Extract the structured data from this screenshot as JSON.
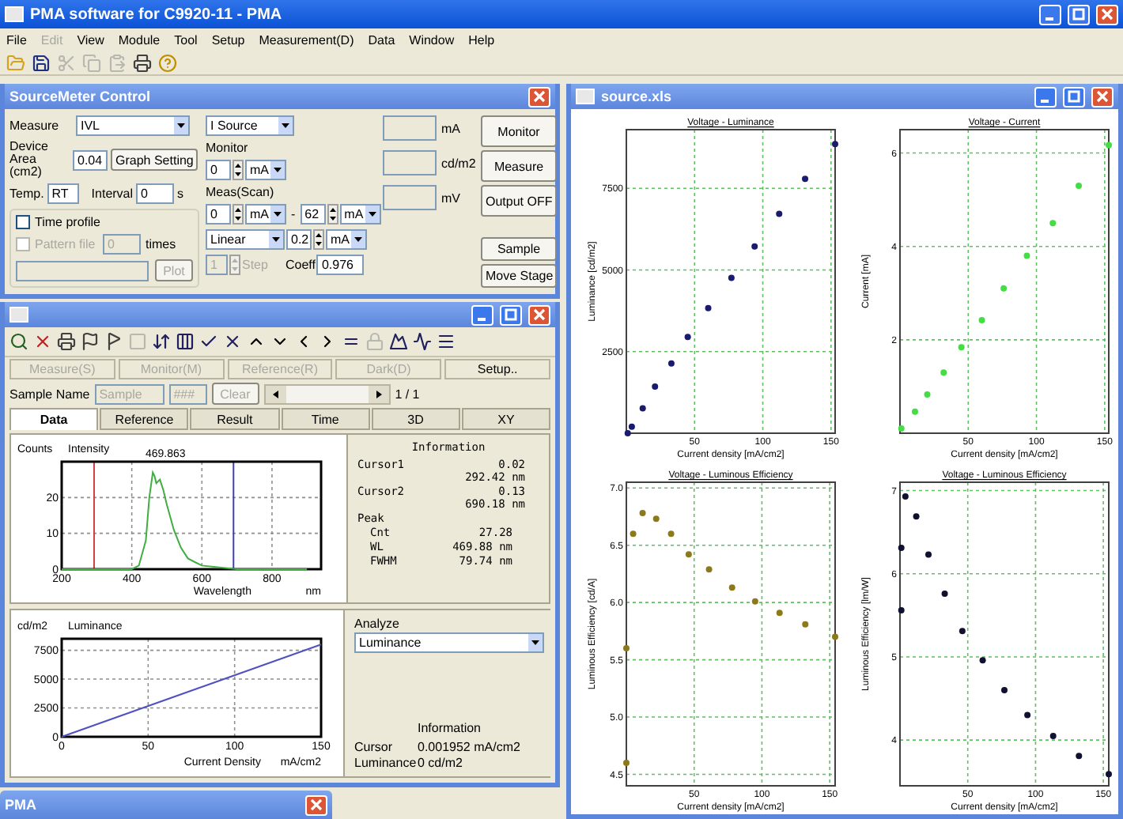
{
  "window": {
    "title": "PMA software for C9920-11 - PMA"
  },
  "menu": [
    {
      "label": "File",
      "disabled": false
    },
    {
      "label": "Edit",
      "disabled": true
    },
    {
      "label": "View",
      "disabled": false
    },
    {
      "label": "Module",
      "disabled": false
    },
    {
      "label": "Tool",
      "disabled": false
    },
    {
      "label": "Setup",
      "disabled": false
    },
    {
      "label": "Measurement(D)",
      "disabled": false
    },
    {
      "label": "Data",
      "disabled": false
    },
    {
      "label": "Window",
      "disabled": false
    },
    {
      "label": "Help",
      "disabled": false
    }
  ],
  "toolbar": [
    {
      "kind": "open",
      "disabled": false
    },
    {
      "kind": "save",
      "disabled": false
    },
    {
      "kind": "cut",
      "disabled": true
    },
    {
      "kind": "copy",
      "disabled": true
    },
    {
      "kind": "paste",
      "disabled": true
    },
    {
      "kind": "print",
      "disabled": false
    },
    {
      "kind": "help",
      "disabled": false
    }
  ],
  "source_meter": {
    "title": "SourceMeter Control",
    "measure": {
      "label": "Measure",
      "value": "IVL"
    },
    "device_area": {
      "label": "Device Area (cm2)",
      "value": "0.04"
    },
    "graph_setting": {
      "label": "Graph Setting"
    },
    "temp": {
      "label": "Temp.",
      "value": "RT"
    },
    "interval": {
      "label": "Interval",
      "value": "0",
      "unit": "s"
    },
    "time_profile": {
      "label": "Time profile",
      "checked": false
    },
    "pattern_file": {
      "label": "Pattern file",
      "checked": false,
      "disabled": true,
      "value": "0",
      "unit": "times"
    },
    "plot": {
      "label": "Plot",
      "disabled": true
    },
    "source": {
      "value": "I Source"
    },
    "monitor": {
      "label": "Monitor",
      "value": "0",
      "unit": "mA"
    },
    "scan": {
      "label": "Meas(Scan)",
      "from": "0",
      "from_unit": "mA",
      "separator": "-",
      "to": "62",
      "to_unit": "mA"
    },
    "mode": {
      "value": "Linear",
      "step": "0.2",
      "step_unit": "mA"
    },
    "steps": {
      "value": "1",
      "label": "Step",
      "disabled": true
    },
    "coeff": {
      "label": "Coeff",
      "value": "0.976"
    },
    "readouts": [
      {
        "unit": "mA"
      },
      {
        "unit": "cd/m2"
      },
      {
        "unit": "mV"
      }
    ],
    "buttons_top": [
      {
        "label": "Monitor"
      },
      {
        "label": "Measure"
      },
      {
        "label": "Output OFF"
      }
    ],
    "buttons_bottom": [
      {
        "label": "Sample"
      },
      {
        "label": "Move Stage"
      }
    ]
  },
  "data_window": {
    "toolbar": [
      {
        "kind": "zoom",
        "disabled": false
      },
      {
        "kind": "delete",
        "disabled": false
      },
      {
        "kind": "print",
        "disabled": false
      },
      {
        "kind": "flag",
        "disabled": false
      },
      {
        "kind": "flag2",
        "disabled": false
      },
      {
        "kind": "blank",
        "disabled": true
      },
      {
        "kind": "sort",
        "disabled": false
      },
      {
        "kind": "columns",
        "disabled": false
      },
      {
        "kind": "check",
        "disabled": false
      },
      {
        "kind": "cross",
        "disabled": false
      },
      {
        "kind": "up",
        "disabled": false
      },
      {
        "kind": "down",
        "disabled": false
      },
      {
        "kind": "left",
        "disabled": false
      },
      {
        "kind": "right",
        "disabled": false
      },
      {
        "kind": "list",
        "disabled": false
      },
      {
        "kind": "lock",
        "disabled": true
      },
      {
        "kind": "peak",
        "disabled": false
      },
      {
        "kind": "wave",
        "disabled": false
      },
      {
        "kind": "lines",
        "disabled": false
      }
    ],
    "commands": [
      {
        "label": "Measure(S)",
        "disabled": true
      },
      {
        "label": "Monitor(M)",
        "disabled": true
      },
      {
        "label": "Reference(R)",
        "disabled": true
      },
      {
        "label": "Dark(D)",
        "disabled": true
      },
      {
        "label": "Setup..",
        "disabled": false
      }
    ],
    "sample": {
      "label": "Sample Name",
      "name": "Sample",
      "code": "###",
      "clear": "Clear",
      "disabled": true,
      "page": "1 / 1"
    },
    "tabs": [
      {
        "label": "Data",
        "selected": true
      },
      {
        "label": "Reference",
        "selected": false
      },
      {
        "label": "Result",
        "selected": false
      },
      {
        "label": "Time",
        "selected": false
      },
      {
        "label": "3D",
        "selected": false
      },
      {
        "label": "XY",
        "selected": false
      }
    ],
    "spectrum": {
      "x_unit": "nm",
      "chart_data": {
        "type": "line",
        "title": "Intensity",
        "xlabel": "Wavelength",
        "ylabel": "Counts",
        "x": [
          200,
          300,
          400,
          420,
          440,
          450,
          460,
          465,
          470,
          480,
          490,
          500,
          520,
          540,
          560,
          580,
          600,
          650,
          700,
          800,
          900
        ],
        "series": [
          {
            "color": "#3fae3f",
            "values": [
              0,
              0,
              0,
              1,
              8,
              20,
              27,
              26,
              24,
              25,
              22,
              18,
              11,
              6,
              3,
              2,
              1,
              0.5,
              0,
              0,
              0
            ]
          }
        ],
        "xlim": [
          200,
          940
        ],
        "ylim": [
          0,
          30
        ],
        "xticks": [
          200,
          400,
          600,
          800
        ],
        "yticks": [
          0,
          10,
          20
        ],
        "grid": true,
        "ref_lines": [
          {
            "axis": "x",
            "value": 292.42,
            "color": "#d04040"
          },
          {
            "axis": "x",
            "value": 690.18,
            "color": "#4040b0"
          }
        ],
        "annotations": [
          {
            "text": "469.863"
          }
        ]
      }
    },
    "info": {
      "title": "Information",
      "items": [
        {
          "kind": "main",
          "label": "Cursor1",
          "values": [
            "0.02",
            "292.42 nm"
          ]
        },
        {
          "kind": "main",
          "label": "Cursor2",
          "values": [
            "0.13",
            "690.18 nm"
          ]
        },
        {
          "kind": "main",
          "label": "Peak"
        },
        {
          "kind": "sub",
          "label": "Cnt",
          "values": [
            "27.28"
          ]
        },
        {
          "kind": "sub",
          "label": "WL",
          "values": [
            "469.88 nm"
          ]
        },
        {
          "kind": "sub",
          "label": "FWHM",
          "values": [
            "79.74 nm"
          ]
        }
      ]
    },
    "luminance": {
      "x_unit": "mA/cm2",
      "chart_data": {
        "type": "line",
        "title": "Luminance",
        "xlabel": "Current Density",
        "ylabel": "cd/m2",
        "x": [
          0,
          150
        ],
        "series": [
          {
            "color": "#5050c0",
            "values": [
              0,
              8000
            ]
          }
        ],
        "xlim": [
          0,
          150
        ],
        "ylim": [
          0,
          8500
        ],
        "xticks": [
          0,
          50,
          100,
          150
        ],
        "yticks": [
          0,
          2500,
          5000,
          7500
        ],
        "grid": true
      }
    },
    "analyze": {
      "label": "Analyze",
      "value": "Luminance",
      "info_title": "Information",
      "rows": [
        {
          "label": "Cursor",
          "value": "0.001952 mA/cm2"
        },
        {
          "label": "Luminance",
          "value": "0 cd/m2"
        }
      ]
    }
  },
  "minimized": {
    "title": "PMA"
  },
  "sheet": {
    "title": "source.xls",
    "charts": [
      {
        "chart_data": {
          "type": "scatter",
          "title": "Voltage - Luminance",
          "xlabel": "Current density [mA/cm2]",
          "ylabel": "Luminance [cd/m2]",
          "x": [
            1,
            4,
            12,
            21,
            33,
            45,
            60,
            77,
            94,
            112,
            131,
            153
          ],
          "series": [
            {
              "color": "#1a1a6e",
              "values": [
                0,
                200,
                760,
                1430,
                2140,
                2950,
                3830,
                4760,
                5720,
                6720,
                7790,
                8860
              ]
            }
          ],
          "xlim": [
            0,
            153
          ],
          "ylim": [
            0,
            9300
          ],
          "xticks": [
            50,
            100,
            150
          ],
          "yticks": [
            2500,
            5000,
            7500
          ],
          "grid": true
        }
      },
      {
        "chart_data": {
          "type": "scatter",
          "title": "Voltage - Current",
          "xlabel": "Current density [mA/cm2]",
          "ylabel": "Current [mA]",
          "x": [
            1,
            11,
            20,
            32,
            45,
            60,
            76,
            93,
            112,
            131,
            153
          ],
          "series": [
            {
              "color": "#44dd44",
              "values": [
                0.1,
                0.46,
                0.83,
                1.3,
                1.84,
                2.42,
                3.1,
                3.8,
                4.5,
                5.3,
                6.17
              ]
            }
          ],
          "xlim": [
            0,
            153
          ],
          "ylim": [
            0,
            6.5
          ],
          "xticks": [
            50,
            100,
            150
          ],
          "yticks": [
            2,
            4,
            6
          ],
          "grid": true
        }
      },
      {
        "chart_data": {
          "type": "scatter",
          "title": "Voltage - Luminous Efficiency",
          "xlabel": "Current density [mA/cm2]",
          "ylabel": "Luminous Efficiency [cd/A]",
          "x": [
            0,
            0,
            5,
            12,
            22,
            33,
            46,
            61,
            78,
            95,
            113,
            132,
            154
          ],
          "series": [
            {
              "color": "#8c7a1a",
              "values": [
                4.6,
                5.6,
                6.6,
                6.78,
                6.73,
                6.6,
                6.42,
                6.29,
                6.13,
                6.01,
                5.91,
                5.81,
                5.7
              ]
            }
          ],
          "xlim": [
            0,
            154
          ],
          "ylim": [
            4.4,
            7.05
          ],
          "xticks": [
            50,
            100,
            150
          ],
          "yticks": [
            4.5,
            {
              "value": 5,
              "label": "5.0"
            },
            5.5,
            {
              "value": 6,
              "label": "6.0"
            },
            6.5,
            {
              "value": 7,
              "label": "7.0"
            }
          ],
          "grid": true
        }
      },
      {
        "chart_data": {
          "type": "scatter",
          "title": "Voltage - Luminous Efficiency",
          "xlabel": "Current density [mA/cm2]",
          "ylabel": "Luminous Efficiency [lm/W]",
          "x": [
            1,
            1,
            4,
            12,
            21,
            33,
            46,
            61,
            77,
            94,
            113,
            132,
            154
          ],
          "series": [
            {
              "color": "#101030",
              "values": [
                6.31,
                5.56,
                6.93,
                6.69,
                6.23,
                5.76,
                5.31,
                4.96,
                4.6,
                4.3,
                4.05,
                3.81,
                3.59
              ]
            }
          ],
          "xlim": [
            0,
            154
          ],
          "ylim": [
            3.45,
            7.1
          ],
          "xticks": [
            50,
            100,
            150
          ],
          "yticks": [
            4,
            5,
            6,
            7
          ],
          "grid": true
        }
      }
    ]
  }
}
